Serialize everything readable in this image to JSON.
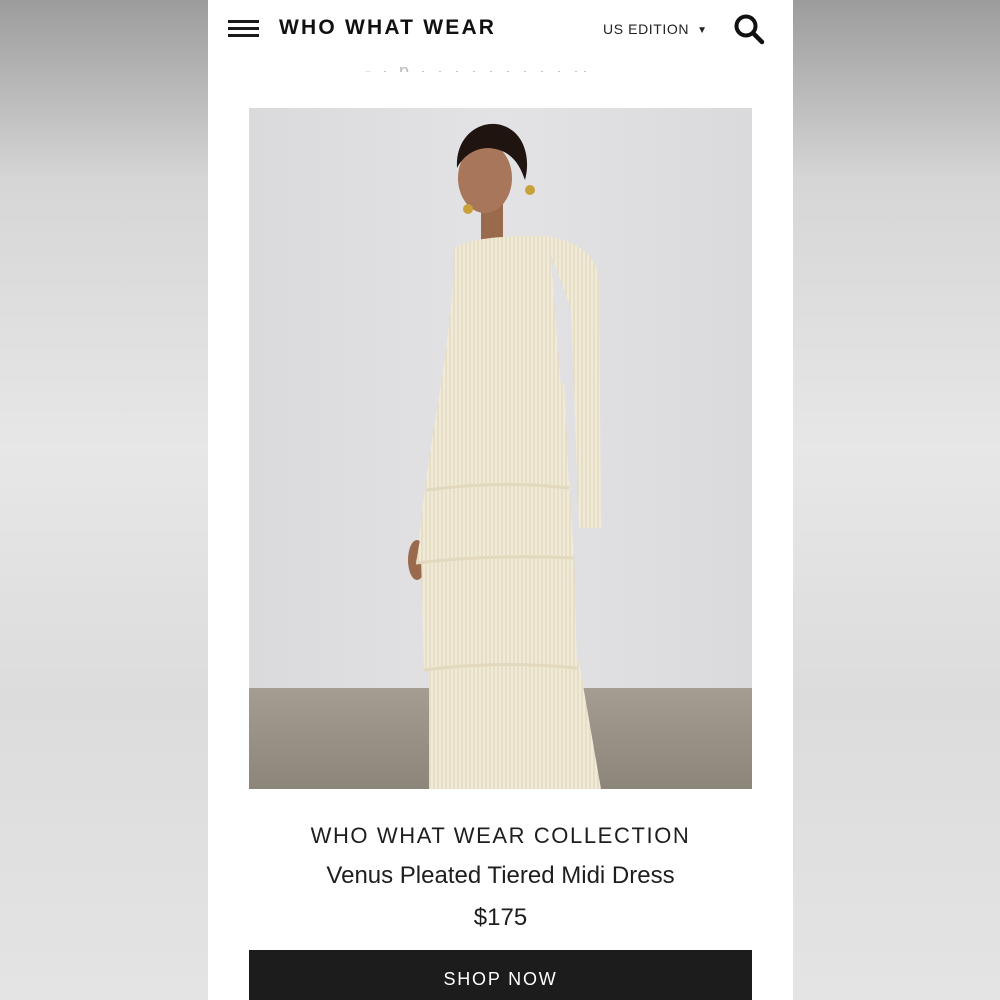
{
  "header": {
    "logo": "WHO WHAT WEAR",
    "edition": "US EDITION",
    "edition_caret": "▼"
  },
  "product": {
    "brand": "WHO WHAT WEAR COLLECTION",
    "name": "Venus Pleated Tiered Midi Dress",
    "price": "$175",
    "cta": "SHOP NOW"
  },
  "colors": {
    "text": "#1e1e1e",
    "button_bg": "#1c1c1c",
    "button_text": "#ffffff",
    "dress": "#f1ead6"
  }
}
